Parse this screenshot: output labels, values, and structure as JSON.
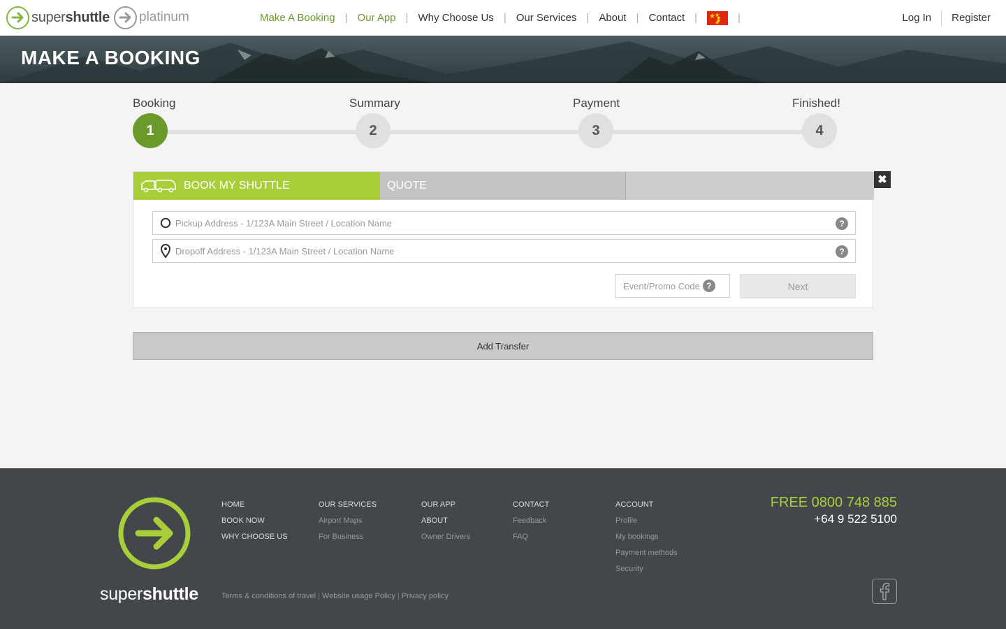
{
  "header": {
    "logo_brand_light": "super",
    "logo_brand_bold": "shuttle",
    "logo_tier": "platinum",
    "nav": [
      {
        "label": "Make A Booking",
        "active": true
      },
      {
        "label": "Our App",
        "active": true
      },
      {
        "label": "Why Choose Us",
        "active": false
      },
      {
        "label": "Our Services",
        "active": false
      },
      {
        "label": "About",
        "active": false
      },
      {
        "label": "Contact",
        "active": false
      }
    ],
    "login_label": "Log In",
    "register_label": "Register"
  },
  "banner": {
    "title": "MAKE A BOOKING"
  },
  "steps": [
    {
      "label": "Booking",
      "number": "1",
      "active": true
    },
    {
      "label": "Summary",
      "number": "2",
      "active": false
    },
    {
      "label": "Payment",
      "number": "3",
      "active": false
    },
    {
      "label": "Finished!",
      "number": "4",
      "active": false
    }
  ],
  "booking": {
    "tab_book": "BOOK MY SHUTTLE",
    "tab_quote": "QUOTE",
    "close_glyph": "✖",
    "pickup_placeholder": "Pickup Address - 1/123A Main Street / Location Name",
    "dropoff_placeholder": "Dropoff Address - 1/123A Main Street / Location Name",
    "help_glyph": "?",
    "promo_label": "Event/Promo Code",
    "next_label": "Next",
    "add_transfer_label": "Add Transfer"
  },
  "footer": {
    "brand_light": "super",
    "brand_bold": "shuttle",
    "col1": [
      "HOME",
      "BOOK NOW",
      "WHY CHOOSE US"
    ],
    "col2_head": "OUR SERVICES",
    "col2": [
      "Airport Maps",
      "For Business"
    ],
    "col3": [
      "OUR APP",
      "ABOUT"
    ],
    "col3_link": "Owner Drivers",
    "col4_head": "CONTACT",
    "col4": [
      "Feedback",
      "FAQ"
    ],
    "col5_head": "ACCOUNT",
    "col5": [
      "Profile",
      "My bookings",
      "Payment methods",
      "Security"
    ],
    "phone_free": "FREE 0800 748 885",
    "phone_intl": "+64 9 522 5100",
    "legal": [
      "Terms & conditions of travel",
      "Website usage Policy",
      "Privacy policy"
    ]
  },
  "colors": {
    "accent": "#a8cf3a",
    "accent_dark": "#6a9a2a",
    "footer_bg": "#43474b"
  }
}
